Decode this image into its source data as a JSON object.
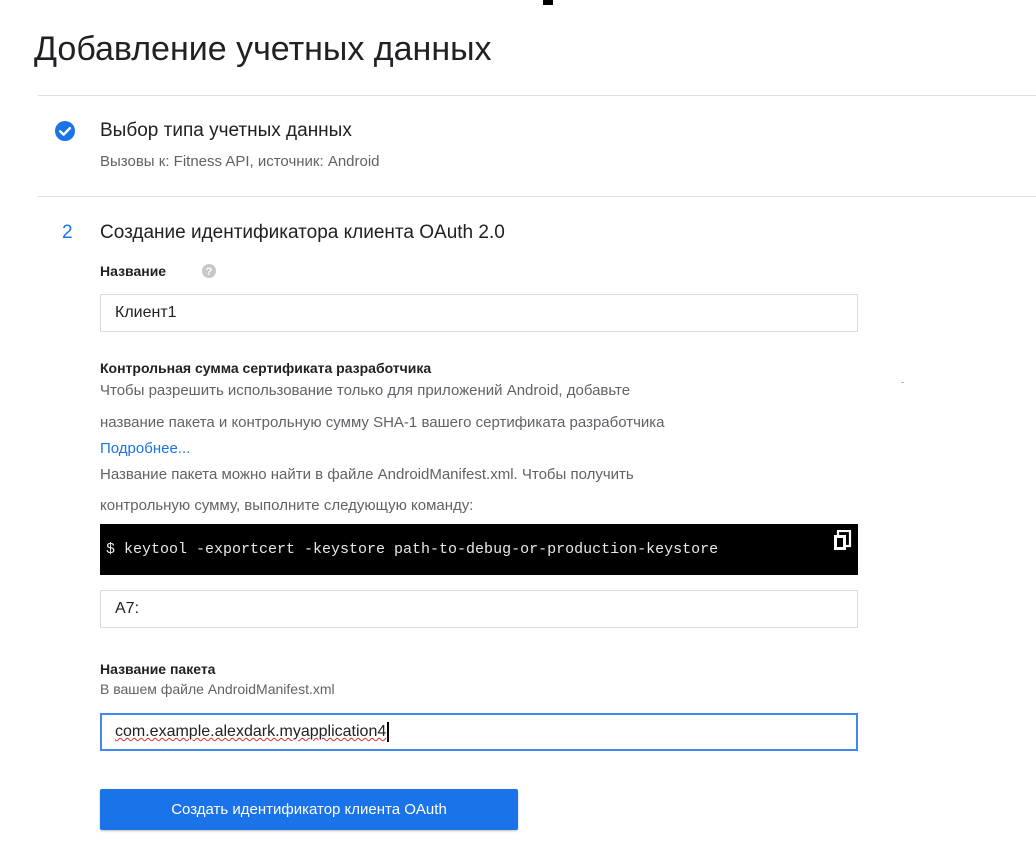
{
  "page": {
    "title": "Добавление учетных данных"
  },
  "step1": {
    "title": "Выбор типа учетных данных",
    "subtitle": "Вызовы к: Fitness API, источник: Android"
  },
  "step2": {
    "number": "2",
    "title": "Создание идентификатора клиента OAuth 2.0",
    "name_label": "Название",
    "name_value": "Клиент1",
    "cert_label": "Контрольная сумма сертификата разработчика",
    "cert_desc_line1": "Чтобы разрешить использование только для приложений Android, добавьте",
    "cert_desc_line2": "название пакета и контрольную сумму SHA-1 вашего сертификата разработчика",
    "learn_more": "Подробнее...",
    "manifest_line1": "Название пакета можно найти в файле AndroidManifest.xml. Чтобы получить",
    "manifest_line2": "контрольную сумму, выполните следующую команду:",
    "command": "$ keytool -exportcert -keystore path-to-debug-or-production-keystore",
    "sha1_value": "A7:",
    "package_label": "Название пакета",
    "package_hint": "В вашем файле AndroidManifest.xml",
    "package_value": "com.example.alexdark.myapplication4",
    "submit_label": "Создать идентификатор клиента OAuth"
  },
  "icons": {
    "step1_status": "check-circle-icon",
    "name_help": "help-icon",
    "command_copy": "copy-icon"
  },
  "colors": {
    "accent": "#1a73e8",
    "command_bg": "#000000"
  }
}
